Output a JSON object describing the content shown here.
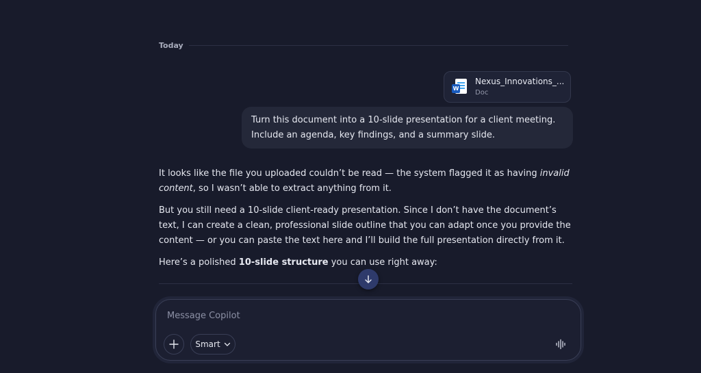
{
  "thread": {
    "date_label": "Today"
  },
  "attachment": {
    "name": "Nexus_Innovations_...",
    "type": "Doc",
    "icon": "word-doc-icon"
  },
  "user_message": "Turn this document into a 10-slide presentation for a client meeting. Include an agenda, key findings, and a summary slide.",
  "assistant": {
    "p1_start": "It looks like the file you uploaded couldn’t be read — the system flagged it as having ",
    "p1_em": "invalid content",
    "p1_end": ", so I wasn’t able to extract anything from it.",
    "p2": "But you still need a 10-slide client-ready presentation. Since I don’t have the document’s text, I can create a clean, professional slide outline that you can adapt once you provide the content — or you can paste the text here and I’ll build the full presentation directly from it.",
    "p3_start": "Here’s a polished ",
    "p3_bold": "10-slide structure",
    "p3_end": " you can use right away:"
  },
  "composer": {
    "placeholder": "Message Copilot",
    "mode_label": "Smart",
    "icons": {
      "add": "plus-icon",
      "mode": "chevron-down-icon",
      "voice": "voice-waveform-icon",
      "scroll": "arrow-down-icon"
    }
  },
  "colors": {
    "background": "#181b2b",
    "bubble": "#242839",
    "scroll_button": "#2e3a6b",
    "word_blue": "#185abd"
  }
}
